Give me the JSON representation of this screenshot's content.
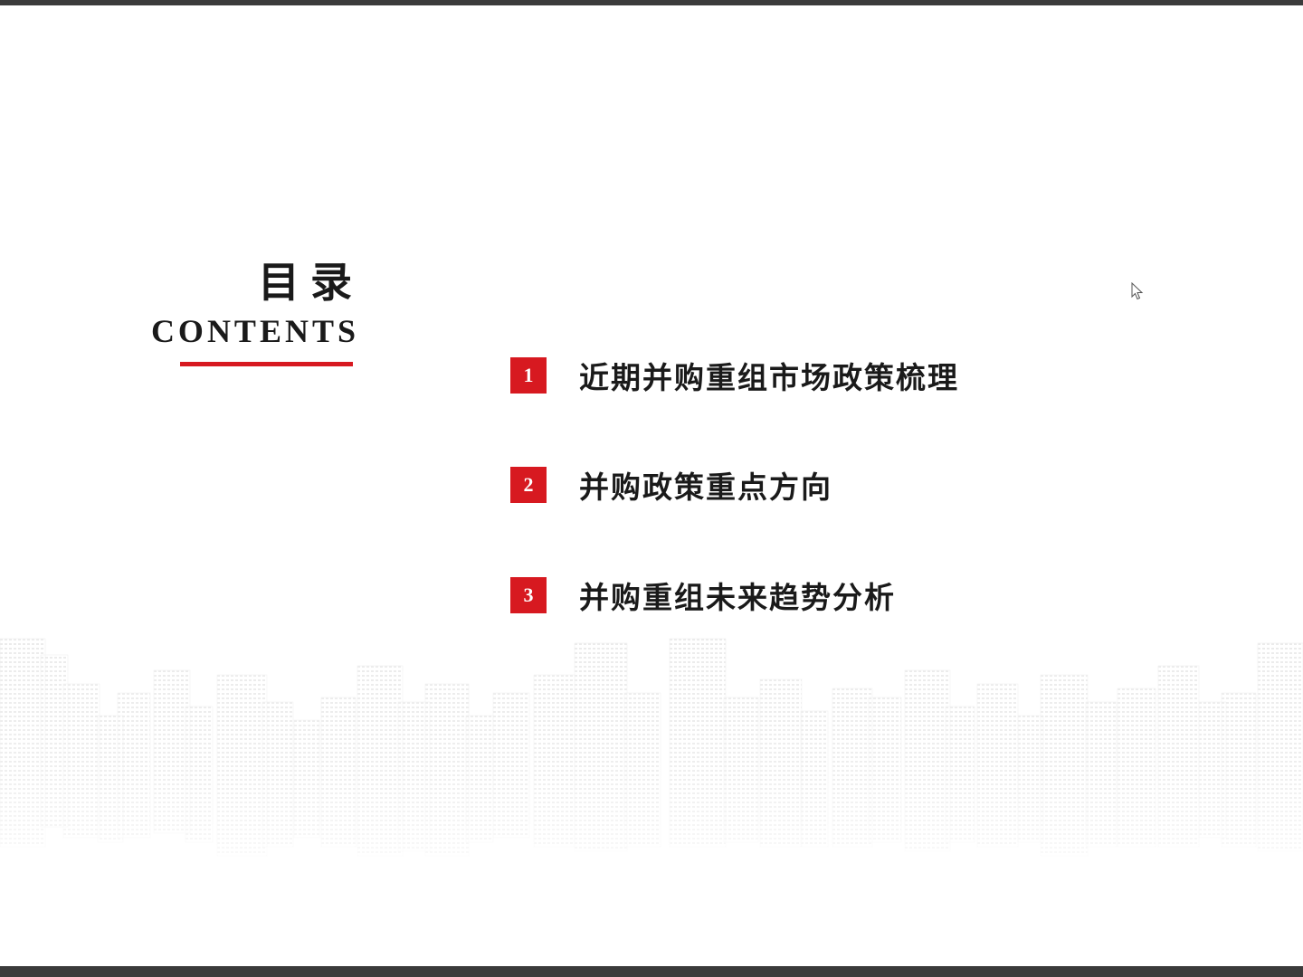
{
  "title": {
    "chinese": "目录",
    "english": "CONTENTS"
  },
  "toc": [
    {
      "number": "1",
      "label": "近期并购重组市场政策梳理"
    },
    {
      "number": "2",
      "label": "并购政策重点方向"
    },
    {
      "number": "3",
      "label": "并购重组未来趋势分析"
    }
  ],
  "colors": {
    "accent": "#d71920",
    "frame": "#3b3b3b",
    "text": "#1a1a1a"
  },
  "icons": {
    "cursor": "mouse-pointer-icon"
  }
}
